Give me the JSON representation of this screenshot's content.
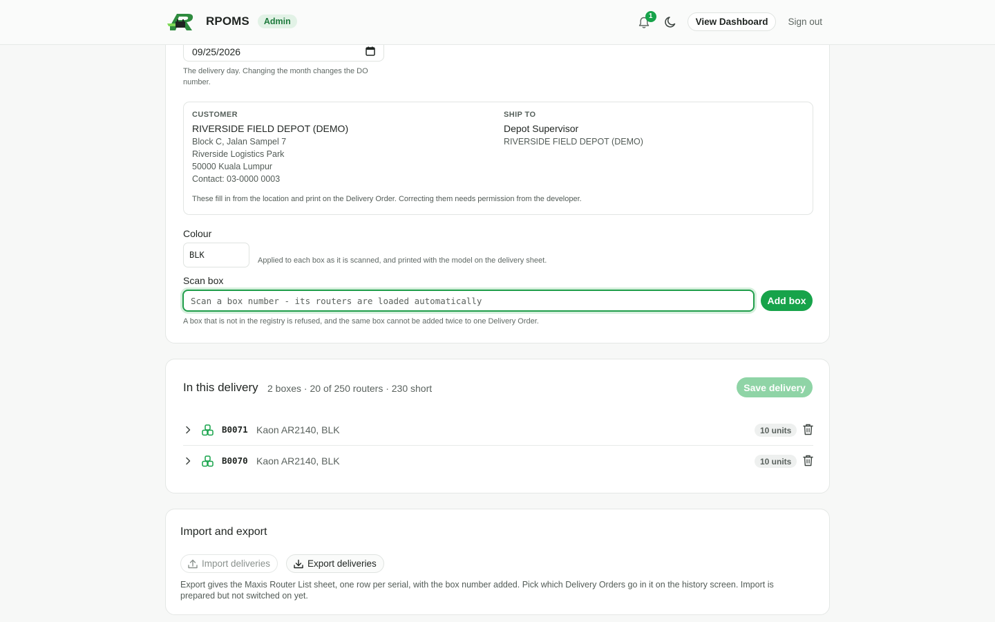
{
  "header": {
    "app_name": "RPOMS",
    "role_badge": "Admin",
    "notification_count": "1",
    "dashboard_button": "View Dashboard",
    "sign_out": "Sign out"
  },
  "delivery_form": {
    "date_value": "09/25/2026",
    "date_hint": "The delivery day. Changing the month changes the DO number.",
    "customer": {
      "label": "CUSTOMER",
      "name": "RIVERSIDE FIELD DEPOT (DEMO)",
      "lines": [
        "Block C, Jalan Sampel 7",
        "Riverside Logistics Park",
        "50000 Kuala Lumpur",
        "Contact: 03-0000 0003"
      ]
    },
    "ship_to": {
      "label": "SHIP TO",
      "name": "Depot Supervisor",
      "line": "RIVERSIDE FIELD DEPOT (DEMO)"
    },
    "address_note": "These fill in from the location and print on the Delivery Order. Correcting them needs permission from the developer.",
    "colour_label": "Colour",
    "colour_value": "BLK",
    "colour_hint": "Applied to each box as it is scanned, and printed with the model on the delivery sheet.",
    "scan_label": "Scan box",
    "scan_placeholder": "Scan a box number - its routers are loaded automatically",
    "add_box_button": "Add box",
    "scan_hint": "A box that is not in the registry is refused, and the same box cannot be added twice to one Delivery Order."
  },
  "in_delivery": {
    "title": "In this delivery",
    "summary": "2 boxes · 20 of 250 routers · 230 short",
    "save_button": "Save delivery",
    "boxes": [
      {
        "id": "B0071",
        "model": "Kaon AR2140, BLK",
        "units": "10 units"
      },
      {
        "id": "B0070",
        "model": "Kaon AR2140, BLK",
        "units": "10 units"
      }
    ]
  },
  "import_export": {
    "title": "Import and export",
    "import_button": "Import deliveries",
    "export_button": "Export deliveries",
    "note": "Export gives the Maxis Router List sheet, one row per serial, with the box number added. Pick which Delivery Orders go in it on the history screen. Import is prepared but not switched on yet."
  },
  "colors": {
    "accent": "#17a34a",
    "accent_disabled": "#8fd4a6",
    "badge_bg": "#e2f2e6"
  },
  "icons": [
    "logo-icon",
    "bell-icon",
    "moon-icon",
    "calendar-icon",
    "chevron-right-icon",
    "boxes-icon",
    "trash-icon",
    "upload-icon",
    "download-icon"
  ]
}
